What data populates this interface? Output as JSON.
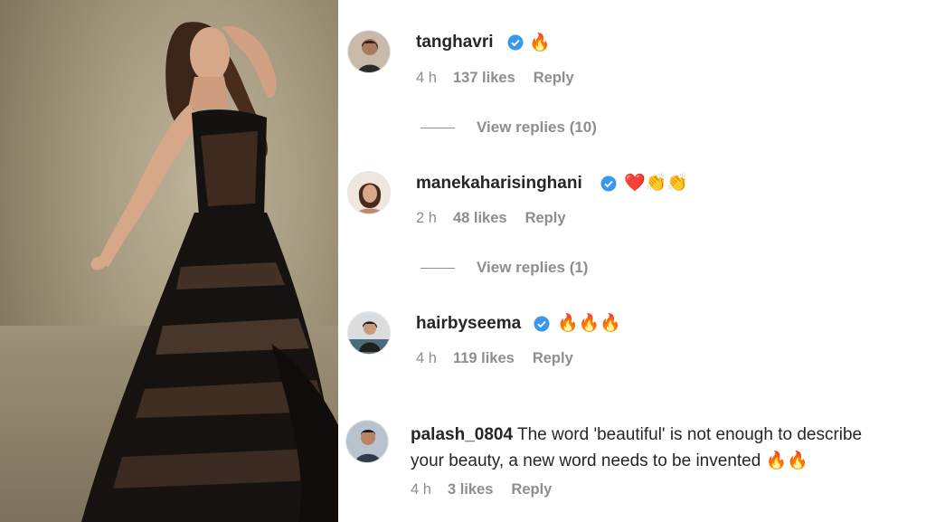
{
  "photo": {
    "description_icon": "post-photo"
  },
  "comments": [
    {
      "username": "tanghavri",
      "verified": true,
      "emoji": "🔥",
      "time": "4 h",
      "likes": "137 likes",
      "reply": "Reply",
      "view_replies": "View replies (10)"
    },
    {
      "username": "manekaharisinghani",
      "verified": true,
      "emoji": "❤️👏👏",
      "time": "2 h",
      "likes": "48 likes",
      "reply": "Reply",
      "view_replies": "View replies (1)"
    },
    {
      "username": "hairbyseema",
      "verified": true,
      "emoji": "🔥🔥🔥",
      "time": "4 h",
      "likes": "119 likes",
      "reply": "Reply"
    },
    {
      "username": "palash_0804",
      "verified": false,
      "text_line1": "The word 'beautiful' is not enough to describe",
      "text_line2": "your beauty, a new word needs to be invented",
      "emoji": "🔥🔥",
      "time": "4 h",
      "likes": "3 likes",
      "reply": "Reply"
    }
  ],
  "colors": {
    "verified_blue": "#3897f0",
    "meta_gray": "#8e8e8e",
    "text": "#262626"
  }
}
